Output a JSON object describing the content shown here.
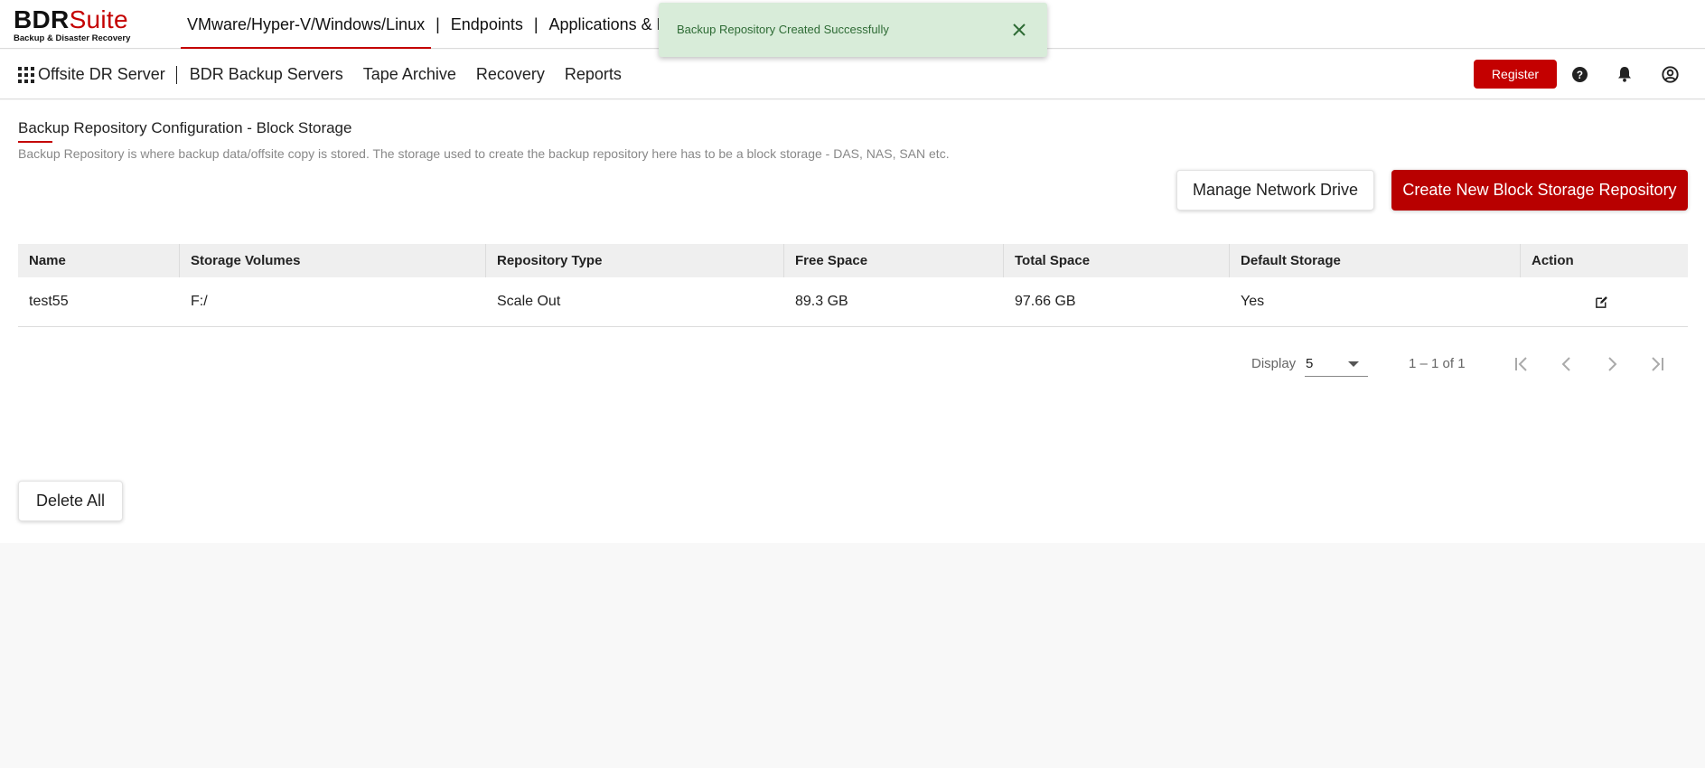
{
  "logo": {
    "brand_bold": "BDR",
    "brand_accent": "Suite",
    "tagline": "Backup & Disaster Recovery"
  },
  "top_nav": {
    "items": [
      {
        "label": "VMware/Hyper-V/Windows/Linux",
        "active": true
      },
      {
        "label": "Endpoints",
        "active": false
      },
      {
        "label": "Applications & D",
        "active": false
      }
    ],
    "separator": "|"
  },
  "toast": {
    "message": "Backup Repository Created Successfully",
    "close_icon": "close-icon"
  },
  "sub_nav": {
    "menu_icon": "apps-grid-icon",
    "items": [
      "Offsite DR Server",
      "BDR Backup Servers",
      "Tape Archive",
      "Recovery",
      "Reports"
    ],
    "separator": "|"
  },
  "header_actions": {
    "register_label": "Register",
    "icons": [
      "help-icon",
      "bell-icon",
      "user-icon"
    ]
  },
  "page": {
    "title": "Backup Repository Configuration - Block Storage",
    "description": "Backup Repository is where backup data/offsite copy is stored. The storage used to create the backup repository here has to be a block storage - DAS, NAS, SAN etc.",
    "manage_network_drive_label": "Manage Network Drive",
    "create_repository_label": "Create New Block Storage Repository",
    "delete_all_label": "Delete All"
  },
  "table": {
    "columns": [
      "Name",
      "Storage Volumes",
      "Repository Type",
      "Free Space",
      "Total Space",
      "Default Storage",
      "Action"
    ],
    "rows": [
      {
        "name": "test55",
        "storage_volumes": "F:/",
        "repository_type": "Scale Out",
        "free_space": "89.3 GB",
        "total_space": "97.66 GB",
        "default_storage": "Yes",
        "action_icon": "edit-icon"
      }
    ]
  },
  "pagination": {
    "display_label": "Display",
    "page_size": "5",
    "range_text": "1 – 1 of 1",
    "icons": [
      "first-page-icon",
      "prev-page-icon",
      "next-page-icon",
      "last-page-icon"
    ]
  },
  "colors": {
    "brand_red": "#c40000",
    "toast_bg": "#d8ecd9",
    "toast_text": "#2e6b35",
    "header_bg": "#efefef"
  }
}
